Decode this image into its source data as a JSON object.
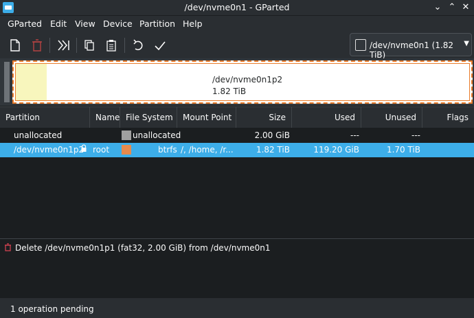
{
  "window": {
    "title": "/dev/nvme0n1 - GParted"
  },
  "menubar": {
    "items": [
      "GParted",
      "Edit",
      "View",
      "Device",
      "Partition",
      "Help"
    ]
  },
  "toolbar": {
    "buttons": [
      "new-partition-icon",
      "delete-icon",
      "resize-move-icon",
      "copy-icon",
      "paste-icon",
      "undo-icon",
      "apply-icon"
    ]
  },
  "device_selector": {
    "value": "/dev/nvme0n1 (1.82 TiB)"
  },
  "partition_map": {
    "name": "/dev/nvme0n1p2",
    "size": "1.82 TiB"
  },
  "table": {
    "columns": [
      "Partition",
      "Name",
      "File System",
      "Mount Point",
      "Size",
      "Used",
      "Unused",
      "Flags"
    ],
    "rows": [
      {
        "partition": "unallocated",
        "name": "",
        "fs_color": "#a0a0a0",
        "filesystem": "unallocated",
        "mount": "",
        "size": "2.00 GiB",
        "used": "---",
        "unused": "---",
        "flags": "",
        "locked": false
      },
      {
        "partition": "/dev/nvme0n1p2",
        "name": "root",
        "fs_color": "#e68a4c",
        "filesystem": "btrfs",
        "mount": "/, /home, /r...",
        "size": "1.82 TiB",
        "used": "119.20 GiB",
        "unused": "1.70 TiB",
        "flags": "",
        "locked": true
      }
    ]
  },
  "operations": [
    "Delete /dev/nvme0n1p1 (fat32, 2.00 GiB) from /dev/nvme0n1"
  ],
  "status": {
    "text": "1 operation pending"
  },
  "colors": {
    "accent": "#3daee9",
    "map_border": "#e97c2d",
    "unallocated": "#a0a0a0",
    "btrfs": "#e68a4c"
  }
}
